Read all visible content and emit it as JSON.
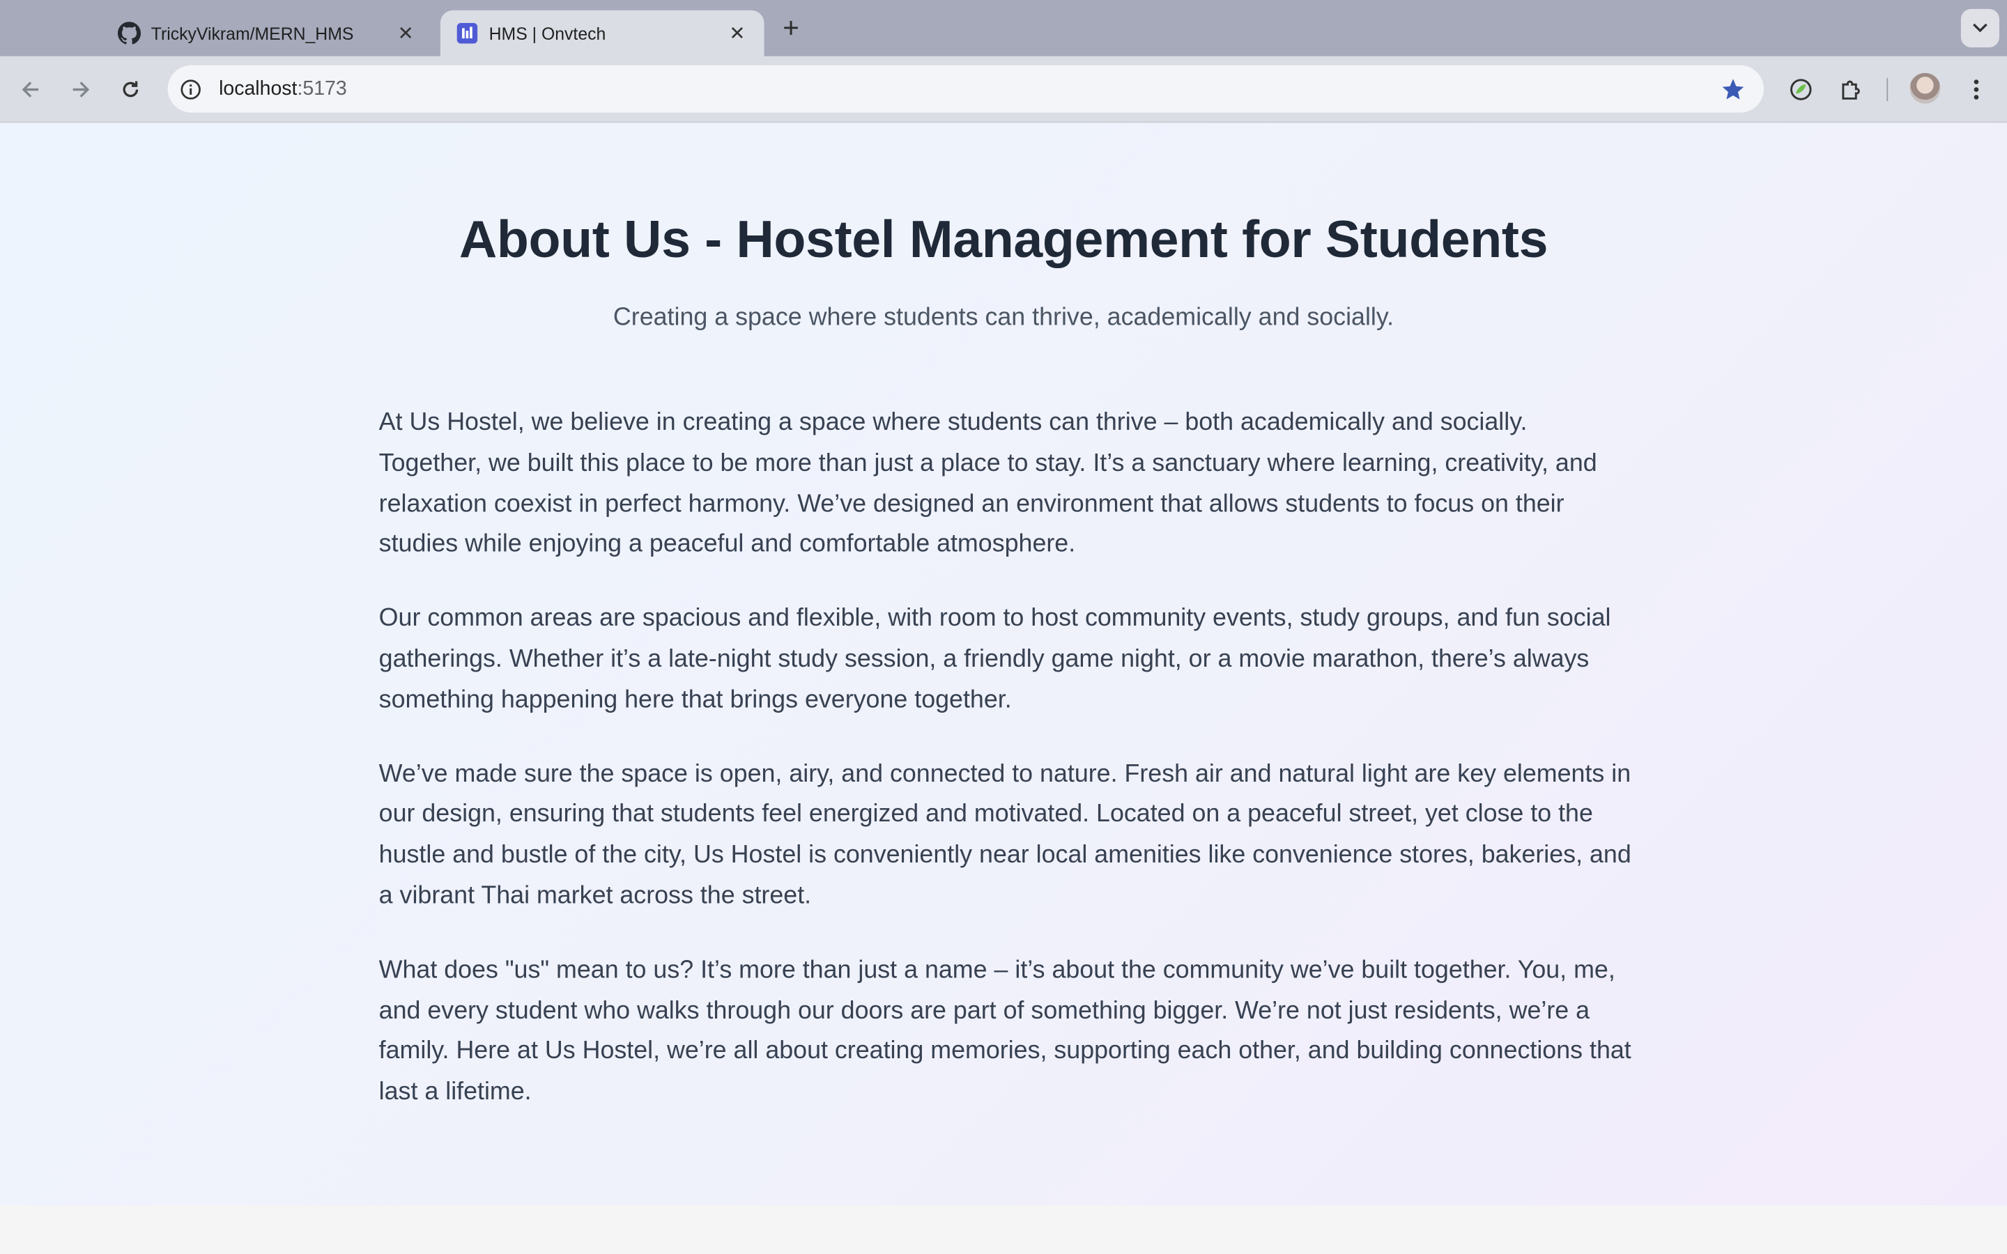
{
  "browser": {
    "tabs": [
      {
        "title": "TrickyVikram/MERN_HMS",
        "icon": "github-icon",
        "active": false
      },
      {
        "title": "HMS | Onvtech",
        "icon": "hms-app-icon",
        "active": true
      }
    ],
    "url_host": "localhost",
    "url_port": ":5173"
  },
  "page": {
    "title": "About Us - Hostel Management for Students",
    "subtitle": "Creating a space where students can thrive, academically and socially.",
    "paragraphs": [
      "At Us Hostel, we believe in creating a space where students can thrive – both academically and socially. Together, we built this place to be more than just a place to stay. It’s a sanctuary where learning, creativity, and relaxation coexist in perfect harmony. We’ve designed an environment that allows students to focus on their studies while enjoying a peaceful and comfortable atmosphere.",
      "Our common areas are spacious and flexible, with room to host community events, study groups, and fun social gatherings. Whether it’s a late-night study session, a friendly game night, or a movie marathon, there’s always something happening here that brings everyone together.",
      "We’ve made sure the space is open, airy, and connected to nature. Fresh air and natural light are key elements in our design, ensuring that students feel energized and motivated. Located on a peaceful street, yet close to the hustle and bustle of the city, Us Hostel is conveniently near local amenities like convenience stores, bakeries, and a vibrant Thai market across the street.",
      "What does \"us\" mean to us? It’s more than just a name – it’s about the community we’ve built together. You, me, and every student who walks through our doors are part of something bigger. We’re not just residents, we’re a family. Here at Us Hostel, we’re all about creating memories, supporting each other, and building connections that last a lifetime."
    ]
  },
  "colors": {
    "heading": "#1f2937",
    "body_text": "#374151",
    "bookmark_star": "#3b5bb5",
    "hms_icon": "#4f5bd5"
  }
}
